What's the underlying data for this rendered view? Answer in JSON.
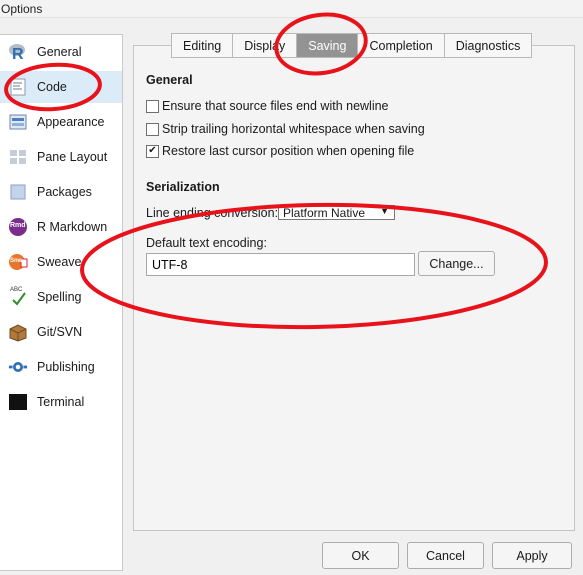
{
  "window": {
    "title": "Options"
  },
  "sidebar": {
    "items": [
      {
        "label": "General",
        "icon": "r-logo-icon"
      },
      {
        "label": "Code",
        "icon": "code-icon"
      },
      {
        "label": "Appearance",
        "icon": "appearance-icon"
      },
      {
        "label": "Pane Layout",
        "icon": "pane-layout-icon"
      },
      {
        "label": "Packages",
        "icon": "packages-icon"
      },
      {
        "label": "R Markdown",
        "icon": "rmd-icon",
        "icon_text": "Rmd"
      },
      {
        "label": "Sweave",
        "icon": "sweave-icon",
        "icon_text": "Snw"
      },
      {
        "label": "Spelling",
        "icon": "spelling-icon",
        "icon_text": "ABC"
      },
      {
        "label": "Git/SVN",
        "icon": "git-svn-icon"
      },
      {
        "label": "Publishing",
        "icon": "publishing-icon"
      },
      {
        "label": "Terminal",
        "icon": "terminal-icon"
      }
    ],
    "selected": "Code"
  },
  "tabs": [
    "Editing",
    "Display",
    "Saving",
    "Completion",
    "Diagnostics"
  ],
  "active_tab": "Saving",
  "general": {
    "title": "General",
    "options": [
      {
        "label": "Ensure that source files end with newline",
        "checked": false
      },
      {
        "label": "Strip trailing horizontal whitespace when saving",
        "checked": false
      },
      {
        "label": "Restore last cursor position when opening file",
        "checked": true
      }
    ]
  },
  "serialization": {
    "title": "Serialization",
    "line_ending_label": "Line ending conversion:",
    "line_ending_value": "Platform Native",
    "encoding_label": "Default text encoding:",
    "encoding_value": "UTF-8",
    "change_button": "Change..."
  },
  "footer": {
    "ok": "OK",
    "cancel": "Cancel",
    "apply": "Apply"
  },
  "check_glyph": "✔",
  "dropdown_glyph": "▼",
  "colors": {
    "annotation": "#e8121a",
    "selected_sidebar": "#dcebf8",
    "active_tab": "#939393"
  }
}
